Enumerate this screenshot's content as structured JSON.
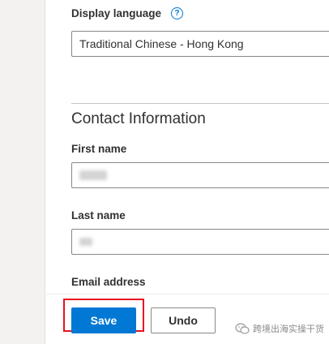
{
  "settings": {
    "display_language": {
      "label": "Display language",
      "help_icon": "help-circle-icon",
      "value": "Traditional Chinese - Hong Kong"
    }
  },
  "contact": {
    "section_title": "Contact Information",
    "first_name": {
      "label": "First name",
      "value_obscured": true
    },
    "last_name": {
      "label": "Last name",
      "value_obscured": true
    },
    "email": {
      "label": "Email address"
    }
  },
  "actions": {
    "save_label": "Save",
    "undo_label": "Undo",
    "accent_color": "#0078d4",
    "highlight_color": "#e81123"
  },
  "watermark": {
    "icon": "wechat-icon",
    "text": "跨境出海实操干货"
  }
}
